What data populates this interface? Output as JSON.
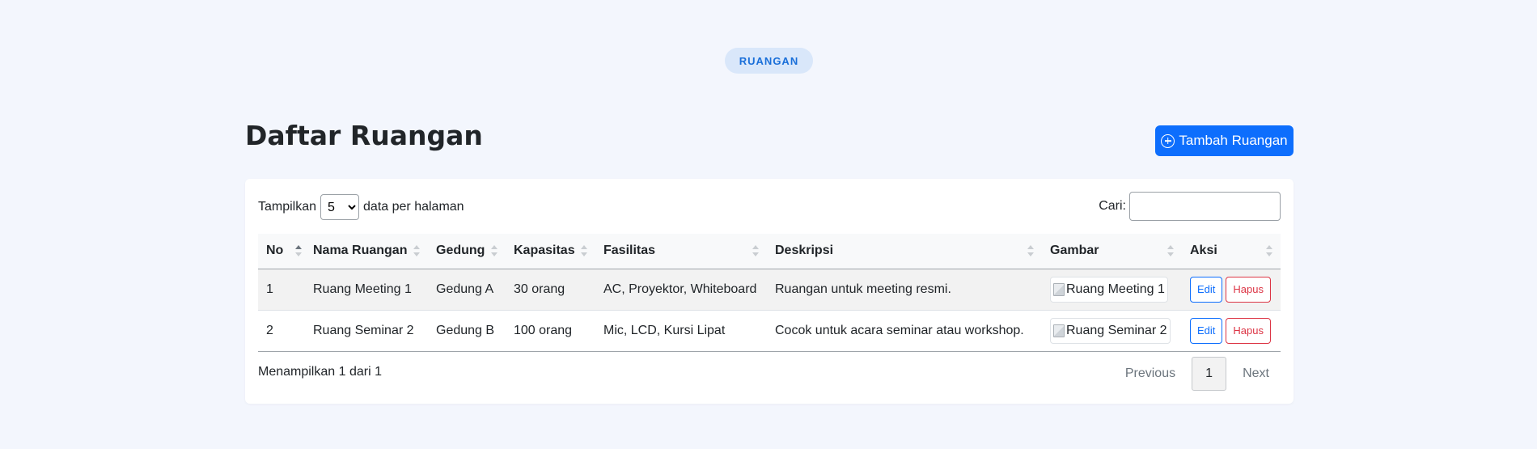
{
  "section_badge": "RUANGAN",
  "page_title": "Daftar Ruangan",
  "add_button": "Tambah Ruangan",
  "length": {
    "prefix": "Tampilkan",
    "value": "5",
    "suffix": "data per halaman"
  },
  "search": {
    "label": "Cari:",
    "value": ""
  },
  "columns": [
    "No",
    "Nama Ruangan",
    "Gedung",
    "Kapasitas",
    "Fasilitas",
    "Deskripsi",
    "Gambar",
    "Aksi"
  ],
  "rows": [
    {
      "no": "1",
      "nama": "Ruang Meeting 1",
      "gedung": "Gedung A",
      "kapasitas": "30 orang",
      "fasilitas": "AC, Proyektor, Whiteboard",
      "deskripsi": "Ruangan untuk meeting resmi.",
      "gambar_alt": "Ruang Meeting 1"
    },
    {
      "no": "2",
      "nama": "Ruang Seminar 2",
      "gedung": "Gedung B",
      "kapasitas": "100 orang",
      "fasilitas": "Mic, LCD, Kursi Lipat",
      "deskripsi": "Cocok untuk acara seminar atau workshop.",
      "gambar_alt": "Ruang Seminar 2"
    }
  ],
  "actions": {
    "edit": "Edit",
    "delete": "Hapus"
  },
  "info": "Menampilkan 1 dari 1",
  "pagination": {
    "previous": "Previous",
    "current": "1",
    "next": "Next"
  },
  "colors": {
    "accent": "#0d6efd",
    "danger": "#dc3545",
    "background": "#f3f6fd",
    "badge_bg": "#d9e7fa"
  }
}
